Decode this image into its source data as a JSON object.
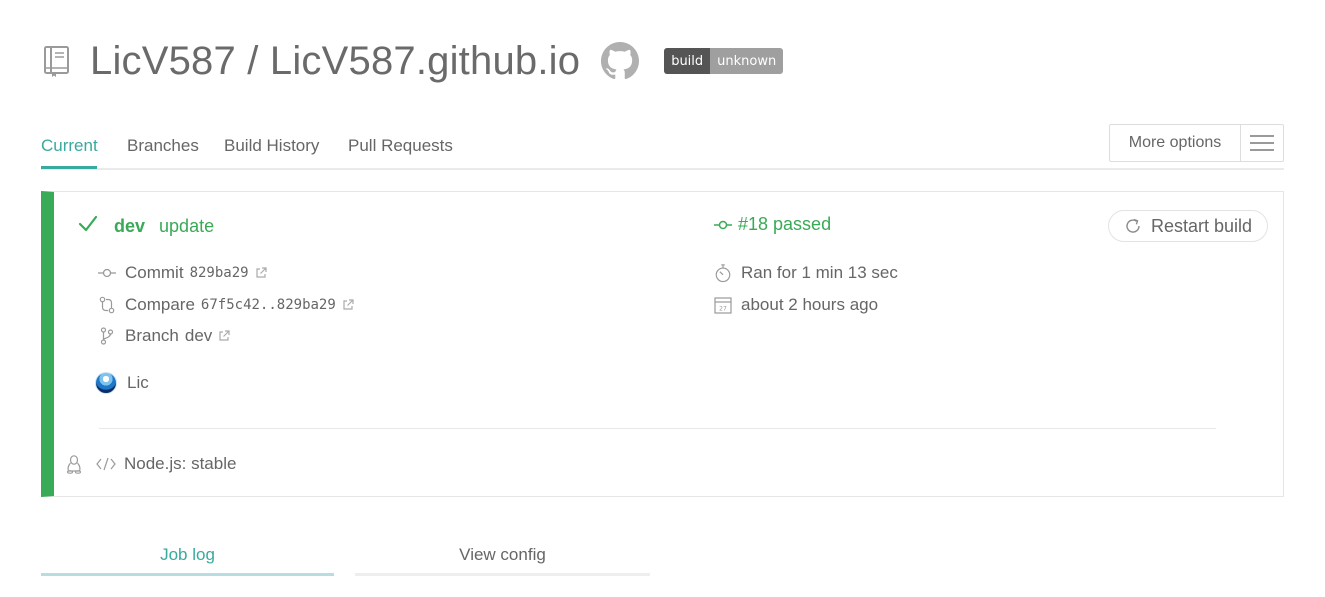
{
  "header": {
    "repo_title": "LicV587 / LicV587.github.io",
    "badge_left": "build",
    "badge_right": "unknown"
  },
  "tabs": [
    {
      "label": "Current",
      "active": true
    },
    {
      "label": "Branches",
      "active": false
    },
    {
      "label": "Build History",
      "active": false
    },
    {
      "label": "Pull Requests",
      "active": false
    }
  ],
  "more_options": {
    "label": "More options"
  },
  "build": {
    "status_color": "#39aa56",
    "branch": "dev",
    "message": "update",
    "build_status": "#18 passed",
    "restart_label": "Restart build",
    "commit_label": "Commit",
    "commit_sha": "829ba29",
    "compare_label": "Compare",
    "compare_range": "67f5c42..829ba29",
    "branch_label": "Branch",
    "branch_value": "dev",
    "duration": "Ran for 1 min 13 sec",
    "finished": "about 2 hours ago",
    "author": "Lic",
    "environment": "Node.js: stable"
  },
  "log_tabs": {
    "job_log": "Job log",
    "view_config": "View config"
  },
  "colors": {
    "accent": "#39aa9d",
    "passed": "#39aa56",
    "badge_dark": "#555555",
    "badge_light": "#9f9f9f"
  }
}
